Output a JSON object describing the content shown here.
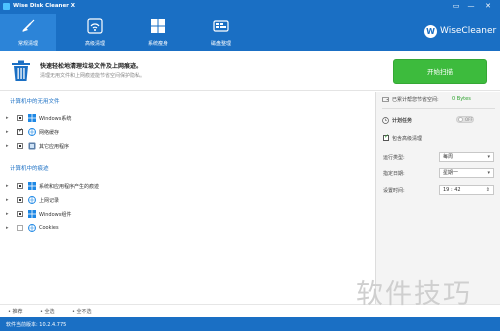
{
  "window": {
    "title": "Wise Disk Cleaner X",
    "buttons": [
      "▭",
      "—",
      "✕"
    ]
  },
  "tabs": [
    {
      "label": "常规清理",
      "icon": "broom-icon",
      "active": true
    },
    {
      "label": "高级清理",
      "icon": "wifi-icon",
      "active": false
    },
    {
      "label": "系统瘦身",
      "icon": "windows-icon",
      "active": false
    },
    {
      "label": "磁盘整理",
      "icon": "disk-icon",
      "active": false
    }
  ],
  "brand": {
    "logo_letter": "W",
    "name": "WiseCleaner"
  },
  "banner": {
    "title": "快速轻松地清理垃圾文件及上网痕迹。",
    "subtitle": "清理无用文件和上网痕迹能节省空间保护隐私。",
    "start_button": "开始扫描"
  },
  "sections": [
    {
      "title": "计算机中的无用文件",
      "items": [
        {
          "label": "Windows系统",
          "check": "partial",
          "icon": "windows-icon"
        },
        {
          "label": "网络缓存",
          "check": "checked",
          "icon": "globe-icon"
        },
        {
          "label": "其它应用程序",
          "check": "partial",
          "icon": "app-icon"
        }
      ]
    },
    {
      "title": "计算机中的痕迹",
      "items": [
        {
          "label": "系统和应用程序产生的痕迹",
          "check": "partial",
          "icon": "windows-icon"
        },
        {
          "label": "上网记录",
          "check": "partial",
          "icon": "globe-icon"
        },
        {
          "label": "Windows组件",
          "check": "partial",
          "icon": "windows-icon"
        },
        {
          "label": "Cookies",
          "check": "empty",
          "icon": "globe-icon"
        }
      ]
    }
  ],
  "right_panel": {
    "saved_label": "已累计帮您节省空间:",
    "saved_value": "0 Bytes",
    "schedule_label": "计划任务",
    "toggle_text": "OFF",
    "advanced_label": "包含高级清理",
    "run_type_label": "运行类型:",
    "run_type_value": "每周",
    "date_label": "指定日期:",
    "date_value": "星期一",
    "time_label": "设置时间:",
    "time_value": "19 : 42"
  },
  "bottom_links": {
    "recommend": "推荐",
    "select_all": "全选",
    "select_none": "全不选"
  },
  "status": {
    "version": "软件当前版本: 10.2.4.775"
  },
  "watermark": "软件技巧",
  "colors": {
    "header": "#1a6fc4",
    "active_tab": "#2c84d8",
    "start_button": "#3dbb3d",
    "saved_value": "#2aa12a"
  }
}
